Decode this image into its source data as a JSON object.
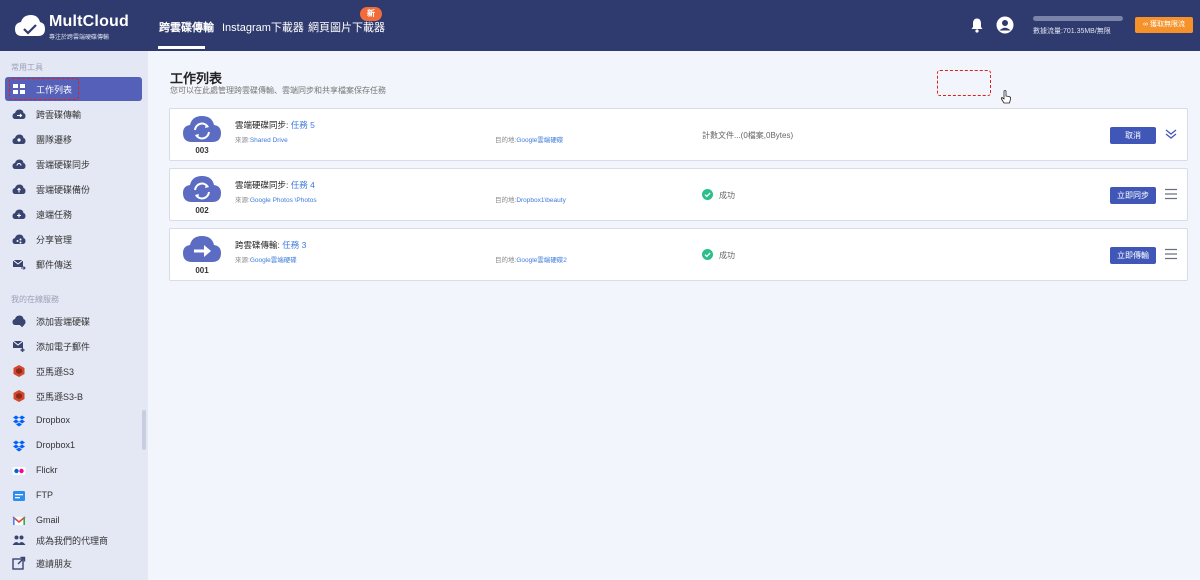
{
  "brand": {
    "name": "MultCloud",
    "tagline": "專注於跨雲端硬碟傳輸"
  },
  "nav": {
    "tabs": [
      {
        "label": "跨雲碟傳輸"
      },
      {
        "label": "Instagram下載器"
      },
      {
        "label": "網頁圖片下載器"
      }
    ],
    "new_badge": "新"
  },
  "header": {
    "traffic_text": "數據流量:701.35MB/無限",
    "upgrade_label": "獲取無限流"
  },
  "sidebar": {
    "section1": "常用工具",
    "tools": [
      {
        "label": "工作列表",
        "icon": "task-list-icon"
      },
      {
        "label": "跨雲碟傳輸",
        "icon": "cloud-transfer-icon"
      },
      {
        "label": "團隊遷移",
        "icon": "team-migration-icon"
      },
      {
        "label": "雲端硬碟同步",
        "icon": "cloud-sync-icon"
      },
      {
        "label": "雲端硬碟備份",
        "icon": "cloud-backup-icon"
      },
      {
        "label": "遠端任務",
        "icon": "remote-task-icon"
      },
      {
        "label": "分享管理",
        "icon": "share-manage-icon"
      },
      {
        "label": "郵件傳送",
        "icon": "email-transfer-icon"
      }
    ],
    "section2": "我的在線服務",
    "services": [
      {
        "label": "添加雲端硬碟",
        "icon": "add-cloud-icon"
      },
      {
        "label": "添加電子郵件",
        "icon": "add-email-icon"
      },
      {
        "label": "亞馬遜S3",
        "icon": "amazon-s3-icon"
      },
      {
        "label": "亞馬遜S3-B",
        "icon": "amazon-s3-icon"
      },
      {
        "label": "Dropbox",
        "icon": "dropbox-icon"
      },
      {
        "label": "Dropbox1",
        "icon": "dropbox-icon"
      },
      {
        "label": "Flickr",
        "icon": "flickr-icon"
      },
      {
        "label": "FTP",
        "icon": "ftp-icon"
      },
      {
        "label": "Gmail",
        "icon": "gmail-icon"
      },
      {
        "label": "成為我們的代理商",
        "icon": "agent-icon"
      },
      {
        "label": "邀請朋友",
        "icon": "invite-icon"
      }
    ]
  },
  "main": {
    "title": "工作列表",
    "subtitle": "您可以在此處管理跨雲碟傳輸、雲端同步和共享檔案保存任務",
    "tasks": [
      {
        "num": "003",
        "type": "雲端硬碟同步: ",
        "name": "任務 5",
        "src_label": "來源:",
        "src": "Shared Drive",
        "dst_label": "目的地:",
        "dst": "Google雲端硬碟",
        "status": "計數文件...(0檔案,0Bytes)",
        "action": "取消"
      },
      {
        "num": "002",
        "type": "雲端硬碟同步: ",
        "name": "任務 4",
        "src_label": "來源:",
        "src": "Google Photos \\Photos",
        "dst_label": "目的地:",
        "dst": "Dropbox1\\beauty",
        "status": "成功",
        "action": "立即同步"
      },
      {
        "num": "001",
        "type": "跨雲碟傳輸: ",
        "name": "任務 3",
        "src_label": "來源:",
        "src": "Google雲端硬碟",
        "dst_label": "目的地:",
        "dst": "Google雲端硬碟2",
        "status": "成功",
        "action": "立即傳輸"
      }
    ]
  },
  "colors": {
    "topbar": "#2f3a6e",
    "accent": "#4057b8",
    "link": "#3d7bdb",
    "success": "#2bbf8a",
    "highlight": "#e0201a",
    "badge": "#f26b3a",
    "upgrade": "#f5922a"
  }
}
